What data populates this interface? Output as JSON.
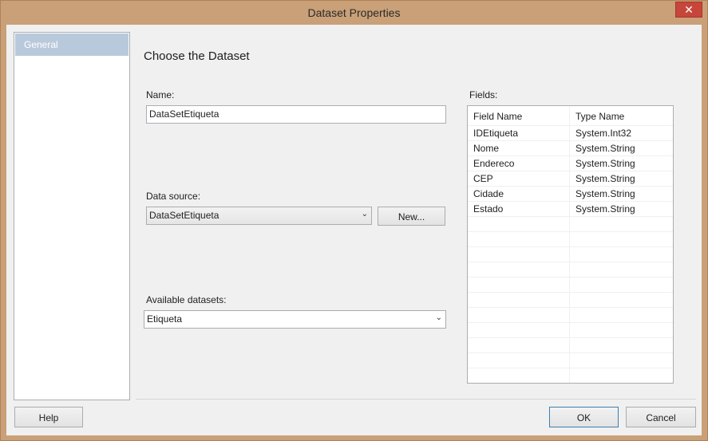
{
  "window": {
    "title": "Dataset Properties",
    "close_glyph": "✕"
  },
  "nav": {
    "items": [
      {
        "label": "General"
      }
    ]
  },
  "page": {
    "heading": "Choose the Dataset"
  },
  "name": {
    "label": "Name:",
    "value": "DataSetEtiqueta"
  },
  "data_source": {
    "label": "Data source:",
    "value": "DataSetEtiqueta",
    "new_button": "New..."
  },
  "available": {
    "label": "Available datasets:",
    "value": "Etiqueta"
  },
  "fields": {
    "label": "Fields:",
    "columns": [
      "Field Name",
      "Type Name"
    ],
    "rows": [
      [
        "IDEtiqueta",
        "System.Int32"
      ],
      [
        "Nome",
        "System.String"
      ],
      [
        "Endereco",
        "System.String"
      ],
      [
        "CEP",
        "System.String"
      ],
      [
        "Cidade",
        "System.String"
      ],
      [
        "Estado",
        "System.String"
      ]
    ]
  },
  "buttons": {
    "help": "Help",
    "ok": "OK",
    "cancel": "Cancel"
  },
  "colors": {
    "title_bar": "#c9a077",
    "close": "#c7463b",
    "nav_selected": "#b9c9dc",
    "default_button_border": "#3c7fb1"
  }
}
